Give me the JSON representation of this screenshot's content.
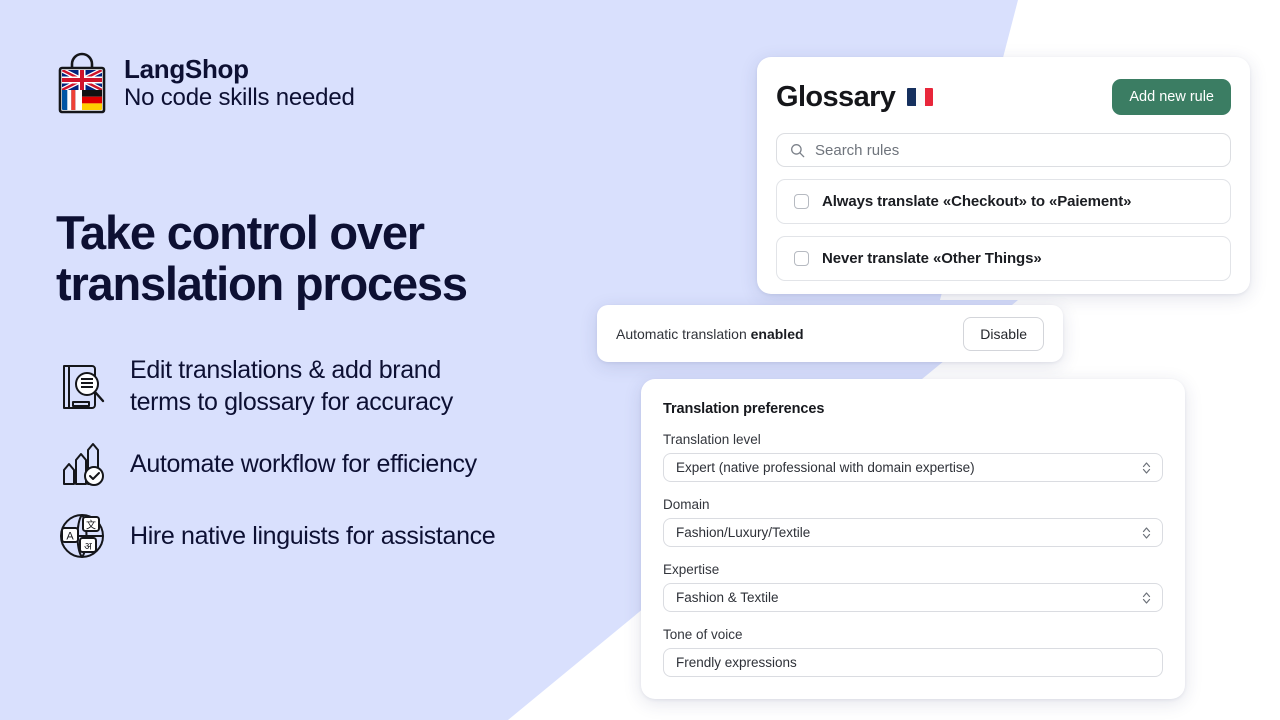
{
  "brand": {
    "logo_icon": "shopping-bag-flags-icon",
    "name": "LangShop",
    "tagline": "No code skills needed"
  },
  "hero": {
    "headline_line1": "Take control over",
    "headline_line2": "translation process",
    "features": [
      {
        "icon": "book-magnifier-icon",
        "line1": "Edit translations & add brand",
        "line2": "terms to glossary for accuracy"
      },
      {
        "icon": "growth-arrows-check-icon",
        "line1": "Automate workflow for efficiency",
        "line2": ""
      },
      {
        "icon": "globe-translate-icon",
        "line1": "Hire native linguists for assistance",
        "line2": ""
      }
    ]
  },
  "glossary": {
    "title": "Glossary",
    "flag_icon": "flag-france-icon",
    "add_button": "Add new rule",
    "search": {
      "icon": "search-icon",
      "value": "",
      "placeholder": "Search rules"
    },
    "rules": [
      {
        "checked": false,
        "label": "Always translate «Checkout» to «Paiement»"
      },
      {
        "checked": false,
        "label": "Never translate «Other Things»"
      }
    ]
  },
  "auto_translation": {
    "label_prefix": "Automatic translation",
    "status": "enabled",
    "button": "Disable"
  },
  "preferences": {
    "title": "Translation preferences",
    "fields": [
      {
        "label": "Translation level",
        "value": "Expert (native professional with domain expertise)",
        "type": "select"
      },
      {
        "label": "Domain",
        "value": "Fashion/Luxury/Textile",
        "type": "select"
      },
      {
        "label": "Expertise",
        "value": "Fashion & Textile",
        "type": "select"
      },
      {
        "label": "Tone of voice",
        "value": "Frendly expressions",
        "type": "text"
      }
    ]
  },
  "colors": {
    "background": "#d9e0fd",
    "text_dark": "#0d1033",
    "accent_green": "#3b7d63",
    "panel_white": "#ffffff"
  }
}
